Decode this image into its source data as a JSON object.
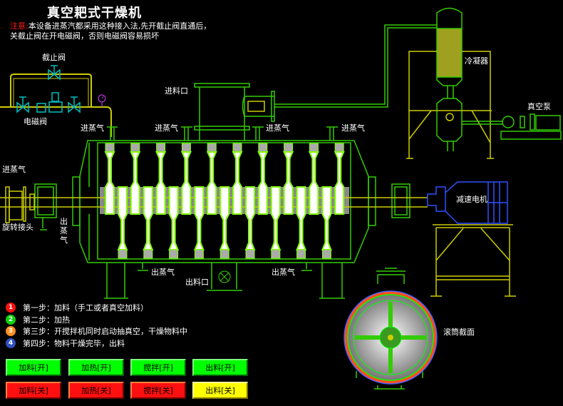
{
  "title": "真空耙式干燥机",
  "notice": {
    "label": "注意:",
    "text": "本设备进蒸汽都采用这种接入法,先开截止阀直通后，关截止阀在开电磁阀，否则电磁阀容易损坏"
  },
  "labels": {
    "shutoff_valve": "截止阀",
    "solenoid_valve": "电磁阀",
    "steam_in": "进蒸气",
    "feed_inlet": "进料口",
    "condenser": "冷凝器",
    "vacuum_pump": "真空泵",
    "gear_motor": "减速电机",
    "rotary_joint": "旋转接头",
    "steam_out": "出蒸气",
    "steam_out_vertical": [
      "出",
      "蒸",
      "气"
    ],
    "discharge": "出料口",
    "drum_section": "滚筒截面"
  },
  "steps": [
    {
      "num": "1",
      "text": "第一步：加料（手工或者真空加料）",
      "color": "#ff1010"
    },
    {
      "num": "2",
      "text": "第二步：加热",
      "color": "#10d010"
    },
    {
      "num": "3",
      "text": "第三步：开搅拌机同时启动抽真空，干燥物料中",
      "color": "#ff9020"
    },
    {
      "num": "4",
      "text": "第四步：物料干燥完毕，出料",
      "color": "#3050c0"
    }
  ],
  "buttons": {
    "on": [
      "加料[开]",
      "加热[开]",
      "搅拌[开]",
      "出料[开]"
    ],
    "off": [
      "加料[关]",
      "加热[关]",
      "搅拌[关]",
      "出料[关]"
    ]
  },
  "colors": {
    "equipment": "#33cc00",
    "pipe": "#cccc00",
    "valve": "#00c0c0",
    "on": "#00ff00",
    "off": "#ff1010",
    "discharge_off": "#ffff00"
  }
}
